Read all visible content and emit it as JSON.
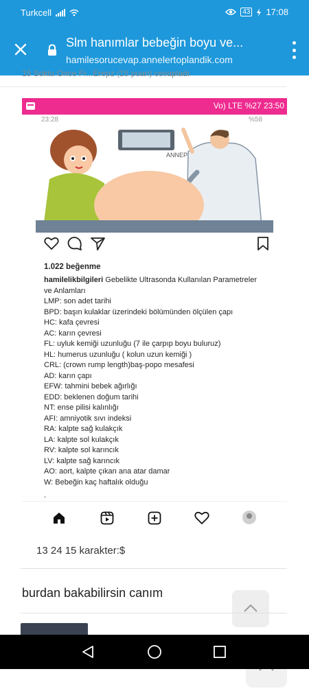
{
  "status_bar": {
    "carrier": "Turkcell",
    "battery": "43",
    "time": "17:08"
  },
  "url_bar": {
    "title": "Slm hanımlar bebeğin boyu ve...",
    "url": "hamilesorucevap.annelertoplandik.com"
  },
  "partial_line": "15 Soktu Once Fr...Erepz (15 puan) cevapladı",
  "embedded_screenshot": {
    "status": {
      "network": "Vo) LTE",
      "battery": "%27",
      "time": "23:50"
    },
    "cut_time": "23:28",
    "cut_right": "%58",
    "watermark": "ANNEPENGUEN",
    "likes": "1.022 beğenme",
    "username": "hamilelikbilgileri",
    "caption_first": "Gebelikte Ultrasonda Kullanılan Parametreler",
    "caption_lines": [
      "ve Anlamları",
      "LMP: son adet tarihi",
      "BPD: başın kulaklar üzerindeki bölümünden ölçülen çapı",
      "HC: kafa çevresi",
      "AC: karın çevresi",
      "FL: uyluk kemiği uzunluğu (7 ile çarpıp boyu buluruz)",
      "HL: humerus uzunluğu ( kolun uzun kemiği )",
      "CRL: (crown rump length)baş-popo mesafesi",
      "AD: karın çapı",
      "EFW: tahmini bebek ağırlığı",
      "EDD: beklenen doğum tarihi",
      "NT: ense pilisi kalınlığı",
      "AFI: amniyotik sıvı indeksi",
      "RA: kalpte sağ kulakçık",
      "LA: kalpte sol kulakçık",
      "RV: kalpte sol karıncık",
      "LV: kalpte sağ karıncık",
      "AO: aort, kalpte çıkan ana atar damar",
      "W: Bebeğin kaç haftalık olduğu"
    ],
    "trailing_dot": "."
  },
  "char_count_text": "13 24 15 karakter:$",
  "answer_text": "burdan bakabilirsin canım",
  "colors": {
    "browser_bar": "#1e98db",
    "phone_status_bar": "#ee2b8f"
  }
}
